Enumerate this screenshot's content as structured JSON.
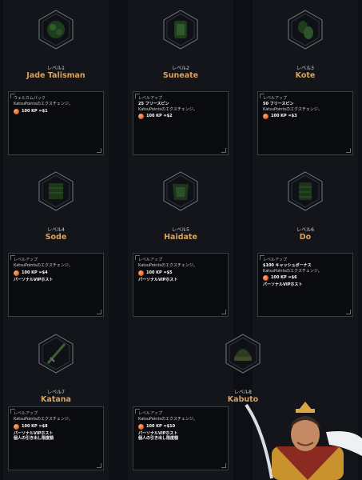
{
  "tiers": [
    {
      "level": "レベル1",
      "name": "Jade Talisman",
      "lines": [
        "ウェルカムパック",
        "KatsuPointsのエクスチェンジ。"
      ],
      "kp": "100 KP =$1",
      "after": []
    },
    {
      "level": "レベル2",
      "name": "Suneate",
      "lines": [
        "レベルアップ",
        "25 フリースピン",
        "KatsuPointsのエクスチェンジ。"
      ],
      "kp": "100 KP =$2",
      "after": []
    },
    {
      "level": "レベル3",
      "name": "Kote",
      "lines": [
        "レベルアップ",
        "50 フリースピン",
        "KatsuPointsのエクスチェンジ。"
      ],
      "kp": "100 KP =$3",
      "after": []
    },
    {
      "level": "レベル4",
      "name": "Sode",
      "lines": [
        "レベルアップ",
        "KatsuPointsのエクスチェンジ。"
      ],
      "kp": "100 KP =$4",
      "after": [
        "パーソナルVIPホスト"
      ]
    },
    {
      "level": "レベル5",
      "name": "Haidate",
      "lines": [
        "レベルアップ",
        "KatsuPointsのエクスチェンジ。"
      ],
      "kp": "100 KP =$5",
      "after": [
        "パーソナルVIPホスト"
      ]
    },
    {
      "level": "レベル6",
      "name": "Do",
      "lines": [
        "レベルアップ",
        "$100 キャッシュボーナス",
        "KatsuPointsのエクスチェンジ。"
      ],
      "kp": "100 KP =$6",
      "after": [
        "パーソナルVIPホスト"
      ]
    },
    {
      "level": "レベル7",
      "name": "Katana",
      "lines": [
        "レベルアップ",
        "KatsuPointsのエクスチェンジ。"
      ],
      "kp": "100 KP =$8",
      "after": [
        "パーソナルVIPホスト",
        "個人の引き出し限度額"
      ]
    },
    {
      "level": "レベル8",
      "name": "Kabuto",
      "lines": [
        "レベルアップ",
        "KatsuPointsのエクスチェンジ。"
      ],
      "kp": "100 KP =$10",
      "after": [
        "パーソナルVIPホスト",
        "個人の引き出し限度額"
      ]
    }
  ],
  "colors": {
    "background": "#0d0f14",
    "column": "#13151b",
    "accent": "#d9a35f",
    "card_border": "#3a3c44",
    "coin": "#e0672b"
  }
}
